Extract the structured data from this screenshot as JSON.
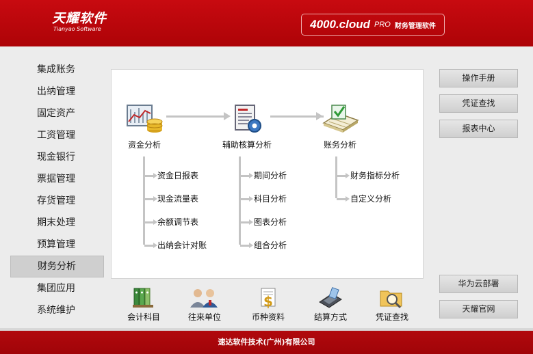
{
  "header": {
    "logo_cn": "天耀软件",
    "logo_en": "Tianyao Software",
    "product_name": "4000.cloud",
    "product_edition": "PRO",
    "product_desc": "财务管理软件"
  },
  "sidebar": {
    "items": [
      {
        "label": "集成账务"
      },
      {
        "label": "出纳管理"
      },
      {
        "label": "固定资产"
      },
      {
        "label": "工资管理"
      },
      {
        "label": "现金银行"
      },
      {
        "label": "票据管理"
      },
      {
        "label": "存货管理"
      },
      {
        "label": "期末处理"
      },
      {
        "label": "预算管理"
      },
      {
        "label": "财务分析"
      },
      {
        "label": "集团应用"
      },
      {
        "label": "系统维护"
      }
    ],
    "active": "财务分析"
  },
  "main": {
    "nodes": [
      {
        "label": "资金分析",
        "icon": "fund-chart-coins-icon"
      },
      {
        "label": "辅助核算分析",
        "icon": "document-gear-icon"
      },
      {
        "label": "账务分析",
        "icon": "ledger-book-icon"
      }
    ],
    "fund_items": [
      "资金日报表",
      "现金流量表",
      "余额调节表",
      "出纳会计对账"
    ],
    "aux_items": [
      "期间分析",
      "科目分析",
      "图表分析",
      "组合分析"
    ],
    "ledger_items": [
      "财务指标分析",
      "自定义分析"
    ]
  },
  "bottom": {
    "items": [
      {
        "label": "会计科目",
        "icon": "binders-icon"
      },
      {
        "label": "往来单位",
        "icon": "people-icon"
      },
      {
        "label": "币种资料",
        "icon": "currency-doc-icon"
      },
      {
        "label": "结算方式",
        "icon": "pos-terminal-icon"
      },
      {
        "label": "凭证查找",
        "icon": "folder-search-icon"
      }
    ]
  },
  "right": {
    "top_buttons": [
      "操作手册",
      "凭证查找",
      "报表中心"
    ],
    "bottom_buttons": [
      "华为云部署",
      "天耀官网"
    ]
  },
  "footer": {
    "company": "速达软件技术(广州)有限公司"
  },
  "colors": {
    "brand_red": "#c80a10",
    "panel_bg": "#ffffff",
    "connector": "#c4c4c4"
  }
}
